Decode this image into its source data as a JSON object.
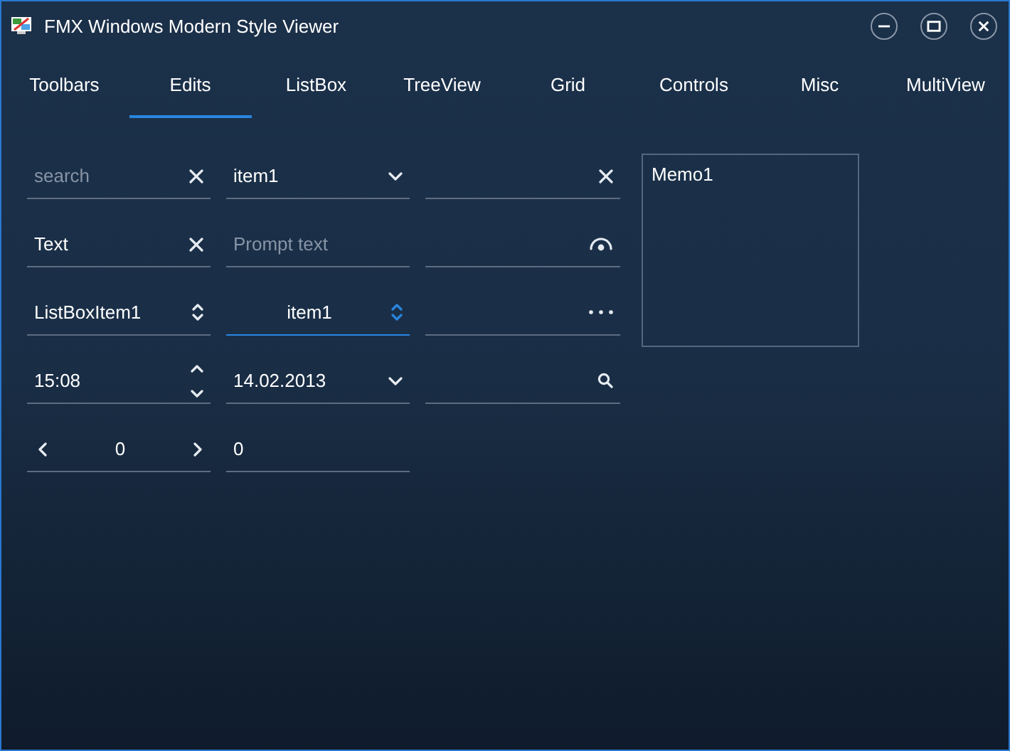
{
  "window": {
    "title": "FMX Windows Modern Style Viewer"
  },
  "tabs": [
    {
      "label": "Toolbars",
      "selected": false
    },
    {
      "label": "Edits",
      "selected": true
    },
    {
      "label": "ListBox",
      "selected": false
    },
    {
      "label": "TreeView",
      "selected": false
    },
    {
      "label": "Grid",
      "selected": false
    },
    {
      "label": "Controls",
      "selected": false
    },
    {
      "label": "Misc",
      "selected": false
    },
    {
      "label": "MultiView",
      "selected": false
    }
  ],
  "fields": [
    {
      "kind": "clear",
      "placeholder": "search",
      "focused": false
    },
    {
      "kind": "dropdown",
      "value": "item1",
      "focused": false
    },
    {
      "kind": "clear",
      "focused": false
    },
    {
      "kind": "clear",
      "value": "Text",
      "focused": false
    },
    {
      "kind": "plain",
      "placeholder": "Prompt text",
      "focused": false
    },
    {
      "kind": "password",
      "focused": false
    },
    {
      "kind": "updown",
      "value": "ListBoxItem1",
      "focused": false
    },
    {
      "kind": "updown-center",
      "value": "item1",
      "focused": true
    },
    {
      "kind": "ellipsis",
      "focused": false
    },
    {
      "kind": "spin",
      "value": "15:08",
      "focused": false
    },
    {
      "kind": "dropdown",
      "value": "14.02.2013",
      "focused": false
    },
    {
      "kind": "search",
      "focused": false
    },
    {
      "kind": "spinbox",
      "value": "0",
      "focused": false
    },
    {
      "kind": "plain",
      "value": "0",
      "focused": false
    }
  ],
  "memo": {
    "text": "Memo1"
  }
}
